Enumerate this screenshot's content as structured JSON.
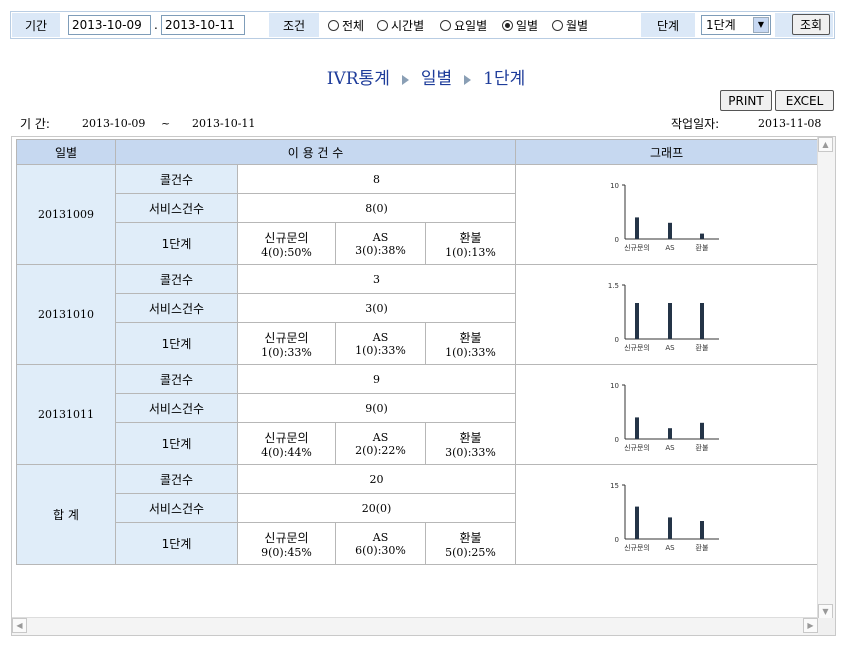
{
  "filter": {
    "period_label": "기간",
    "date_from": "2013-10-09",
    "date_sep": ".",
    "date_to": "2013-10-11",
    "condition_label": "조건",
    "options": [
      "전체",
      "시간별",
      "요일별",
      "일별",
      "월별"
    ],
    "selected_option": "일별",
    "level_label": "단계",
    "level_value": "1단계",
    "search_button": "조회"
  },
  "breadcrumb": {
    "part1": "IVR통계",
    "part2": "일별",
    "part3": "1단계"
  },
  "actions": {
    "print": "PRINT",
    "excel": "EXCEL"
  },
  "info": {
    "period_label": "기 간:",
    "from": "2013-10-09",
    "tilde": "~",
    "to": "2013-10-11",
    "workdate_label": "작업일자:",
    "workdate": "2013-11-08"
  },
  "table": {
    "headers": {
      "day": "일별",
      "usage": "이 용 건 수",
      "graph": "그래프"
    },
    "row_labels": {
      "calls": "콜건수",
      "service": "서비스건수",
      "level": "1단계"
    },
    "category_labels": [
      "신규문의",
      "AS",
      "환불"
    ],
    "groups": [
      {
        "day": "20131009",
        "calls": "8",
        "service": "8(0)",
        "stats": [
          "4(0):50%",
          "3(0):38%",
          "1(0):13%"
        ]
      },
      {
        "day": "20131010",
        "calls": "3",
        "service": "3(0)",
        "stats": [
          "1(0):33%",
          "1(0):33%",
          "1(0):33%"
        ]
      },
      {
        "day": "20131011",
        "calls": "9",
        "service": "9(0)",
        "stats": [
          "4(0):44%",
          "2(0):22%",
          "3(0):33%"
        ]
      },
      {
        "day": "합 계",
        "calls": "20",
        "service": "20(0)",
        "stats": [
          "9(0):45%",
          "6(0):30%",
          "5(0):25%"
        ]
      }
    ]
  },
  "chart_data": [
    {
      "type": "bar",
      "categories": [
        "신규문의",
        "AS",
        "환불"
      ],
      "values": [
        4,
        3,
        1
      ],
      "ylim": [
        0,
        10
      ],
      "ytick_labels": [
        "0",
        "10"
      ]
    },
    {
      "type": "bar",
      "categories": [
        "신규문의",
        "AS",
        "환불"
      ],
      "values": [
        1,
        1,
        1
      ],
      "ylim": [
        0,
        1.5
      ],
      "ytick_labels": [
        "0",
        "1.5"
      ]
    },
    {
      "type": "bar",
      "categories": [
        "신규문의",
        "AS",
        "환불"
      ],
      "values": [
        4,
        2,
        3
      ],
      "ylim": [
        0,
        10
      ],
      "ytick_labels": [
        "0",
        "10"
      ]
    },
    {
      "type": "bar",
      "categories": [
        "신규문의",
        "AS",
        "환불"
      ],
      "values": [
        9,
        6,
        5
      ],
      "ylim": [
        0,
        15
      ],
      "ytick_labels": [
        "0",
        "15"
      ]
    }
  ],
  "colors": {
    "header_bg": "#c6d8f0",
    "label_bg": "#e0edf9",
    "breadcrumb": "#1e3c9a",
    "bar": "#243447"
  }
}
